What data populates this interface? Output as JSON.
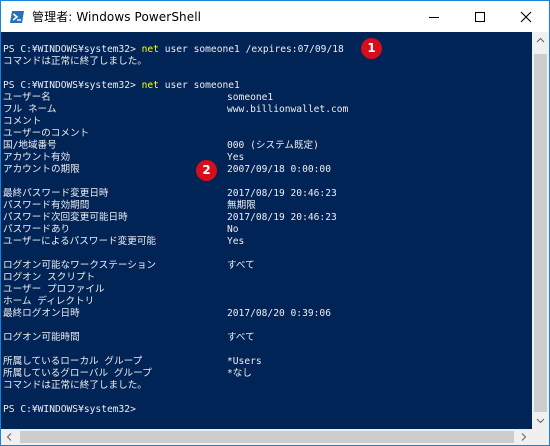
{
  "window": {
    "title": "管理者: Windows PowerShell",
    "icon": "powershell-icon",
    "controls": [
      "minimize-icon",
      "maximize-icon",
      "close-icon"
    ]
  },
  "colors": {
    "console_bg": "#012456",
    "console_text": "#eeedf0",
    "command_keyword": "#ffff00",
    "marker": "#d70d1a",
    "window_border": "#1883d7"
  },
  "console": {
    "cmd1": {
      "prompt": "PS C:¥WINDOWS¥system32> ",
      "keyword": "net",
      "args": " user someone1 /expires:07/09/18"
    },
    "result1": "コマンドは正常に終了しました。",
    "cmd2": {
      "prompt": "PS C:¥WINDOWS¥system32> ",
      "keyword": "net",
      "args": " user someone1"
    },
    "props": [
      {
        "label": "ユーザー名",
        "value": "someone1"
      },
      {
        "label": "フル ネーム",
        "value": "www.billionwallet.com"
      },
      {
        "label": "コメント",
        "value": ""
      },
      {
        "label": "ユーザーのコメント",
        "value": ""
      },
      {
        "label": "国/地域番号",
        "value": "000 (システム既定)"
      },
      {
        "label": "アカウント有効",
        "value": "Yes"
      },
      {
        "label": "アカウントの期限",
        "value": "2007/09/18 0:00:00"
      },
      {
        "label": "最終パスワード変更日時",
        "value": "2017/08/19 20:46:23"
      },
      {
        "label": "パスワード有効期間",
        "value": "無期限"
      },
      {
        "label": "パスワード次回変更可能日時",
        "value": "2017/08/19 20:46:23"
      },
      {
        "label": "パスワードあり",
        "value": "No"
      },
      {
        "label": "ユーザーによるパスワード変更可能",
        "value": "Yes"
      },
      {
        "label": "ログオン可能なワークステーション",
        "value": "すべて"
      },
      {
        "label": "ログオン スクリプト",
        "value": ""
      },
      {
        "label": "ユーザー プロファイル",
        "value": ""
      },
      {
        "label": "ホーム ディレクトリ",
        "value": ""
      },
      {
        "label": "最終ログオン日時",
        "value": "2017/08/20 0:39:06"
      },
      {
        "label": "ログオン可能時間",
        "value": "すべて"
      },
      {
        "label": "所属しているローカル グループ",
        "value": "*Users"
      },
      {
        "label": "所属しているグローバル グループ",
        "value": "*なし"
      }
    ],
    "result2": "コマンドは正常に終了しました。",
    "final_prompt": "PS C:¥WINDOWS¥system32>"
  },
  "markers": [
    "1",
    "2"
  ]
}
